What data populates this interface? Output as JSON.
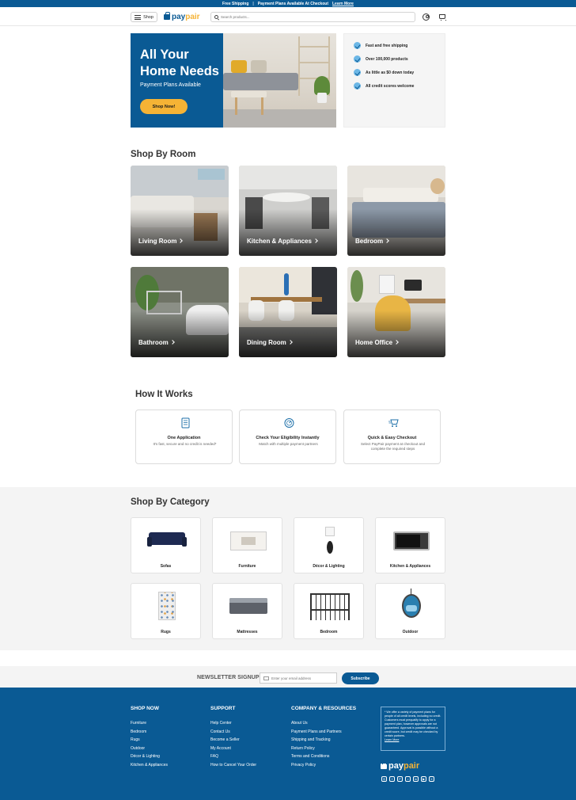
{
  "announcement": {
    "left": "Free Shipping",
    "right": "Payment Plans Available At Checkout",
    "link": "Learn More"
  },
  "header": {
    "shop_label": "Shop",
    "logo_pay": "pay",
    "logo_pair": "pair",
    "search_placeholder": "Search products..."
  },
  "hero": {
    "title": "All Your Home Needs",
    "subtitle": "Payment Plans Available",
    "cta": "Shop Now!"
  },
  "features": [
    "Fast and free shipping",
    "Over 100,000 products",
    "As little as $0 down today",
    "All credit scores welcome"
  ],
  "rooms": {
    "title": "Shop By Room",
    "items": [
      "Living Room",
      "Kitchen & Appliances",
      "Bedroom",
      "Bathroom",
      "Dining Room",
      "Home Office"
    ]
  },
  "how": {
    "title": "How It Works",
    "steps": [
      {
        "title": "One Application",
        "desc": "It's fast, secure and no credit is needed*"
      },
      {
        "title": "Check Your Eligibility Instantly",
        "desc": "Match with multiple payment partners"
      },
      {
        "title": "Quick & Easy Checkout",
        "desc": "Select PayPair payment at checkout and complete the required steps"
      }
    ]
  },
  "categories": {
    "title": "Shop By Category",
    "items": [
      "Sofas",
      "Furniture",
      "Décor & Lighting",
      "Kitchen & Appliances",
      "Rugs",
      "Mattresses",
      "Bedroom",
      "Outdoor"
    ]
  },
  "newsletter": {
    "title": "NEWSLETTER SIGNUP",
    "placeholder": "Enter your email address",
    "button": "Subscribe"
  },
  "footer": {
    "shop_now": {
      "title": "SHOP NOW",
      "links": [
        "Furniture",
        "Bedroom",
        "Rugs",
        "Outdoor",
        "Décor & Lighting",
        "Kitchen & Appliances"
      ]
    },
    "support": {
      "title": "SUPPORT",
      "links": [
        "Help Center",
        "Contact Us",
        "Become a Seller",
        "My Account",
        "FAQ",
        "How to Cancel Your Order"
      ]
    },
    "company": {
      "title": "COMPANY & RESOURCES",
      "links": [
        "About Us",
        "Payment Plans and Partners",
        "Shipping and Tracking",
        "Return Policy",
        "Terms and Conditions",
        "Privacy Policy"
      ]
    },
    "disclaimer": "* We offer a variety of payment plans for people of all credit levels, including no credit. Customers must prequalify to apply for a payment plan, however approvals are not guaranteed. Approval is possible without a credit score, but credit may be checked by certain partners.",
    "disclaimer_link": "Learn More",
    "social": [
      "instagram-icon",
      "facebook-icon",
      "pinterest-icon",
      "tiktok-icon",
      "linkedin-icon",
      "youtube-icon",
      "x-icon"
    ]
  },
  "colors": {
    "brand": "#0a5a94",
    "accent": "#f5b335",
    "check": "#6cb7e6"
  }
}
